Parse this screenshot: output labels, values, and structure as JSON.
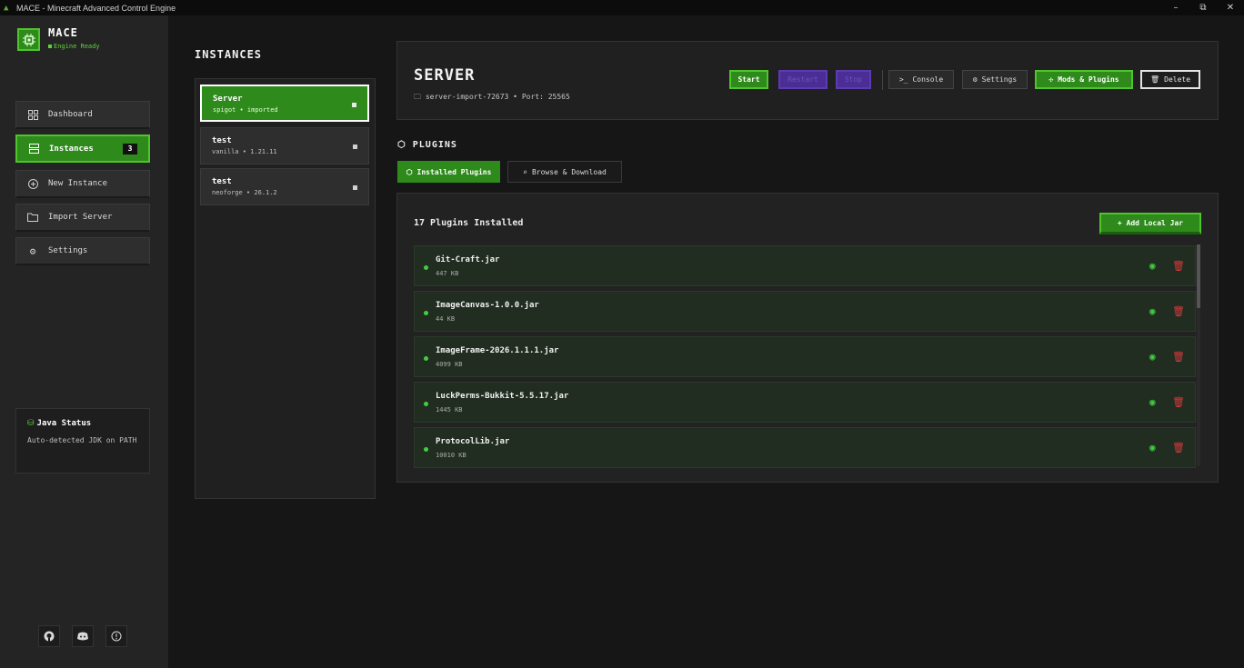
{
  "window": {
    "title": "MACE - Minecraft Advanced Control Engine",
    "controls": {
      "minimize": "–",
      "restore": "⧉",
      "close": "✕"
    }
  },
  "brand": {
    "name": "MACE",
    "status": "Engine Ready"
  },
  "sidebar": {
    "items": [
      {
        "label": "Dashboard",
        "icon": "grid-icon"
      },
      {
        "label": "Instances",
        "icon": "server-icon",
        "badge": "3",
        "active": true
      },
      {
        "label": "New Instance",
        "icon": "plus-circle-icon"
      },
      {
        "label": "Import Server",
        "icon": "folder-icon"
      },
      {
        "label": "Settings",
        "icon": "gear-icon"
      }
    ],
    "java": {
      "title": "Java Status",
      "description": "Auto-detected JDK on PATH"
    },
    "social": [
      "github-icon",
      "discord-icon",
      "info-icon"
    ]
  },
  "instances": {
    "heading": "INSTANCES",
    "items": [
      {
        "name": "Server",
        "meta": "spigot • imported",
        "active": true
      },
      {
        "name": "test",
        "meta": "vanilla • 1.21.11"
      },
      {
        "name": "test",
        "meta": "neoforge • 26.1.2"
      }
    ]
  },
  "server": {
    "name": "SERVER",
    "folder": "server-import-72673",
    "port": "Port: 25565",
    "buttons": {
      "start": "Start",
      "restart": "Restart",
      "stop": "Stop",
      "console": "Console",
      "settings": "Settings",
      "mods": "Mods & Plugins",
      "delete": "Delete"
    }
  },
  "plugins": {
    "heading": "PLUGINS",
    "tabs": {
      "installed": "Installed Plugins",
      "browse": "Browse & Download"
    },
    "count_label": "17 Plugins Installed",
    "add_button": "+ Add Local Jar",
    "items": [
      {
        "name": "Git-Craft.jar",
        "size": "447 KB"
      },
      {
        "name": "ImageCanvas-1.0.0.jar",
        "size": "44 KB"
      },
      {
        "name": "ImageFrame-2026.1.1.1.jar",
        "size": "4099 KB"
      },
      {
        "name": "LuckPerms-Bukkit-5.5.17.jar",
        "size": "1445 KB"
      },
      {
        "name": "ProtocolLib.jar",
        "size": "10010 KB"
      }
    ]
  },
  "colors": {
    "accent": "#2f8a1c",
    "accent_border": "#4fc42b",
    "purple": "#4b2d96",
    "danger": "#d83a3a",
    "background": "#161616"
  }
}
